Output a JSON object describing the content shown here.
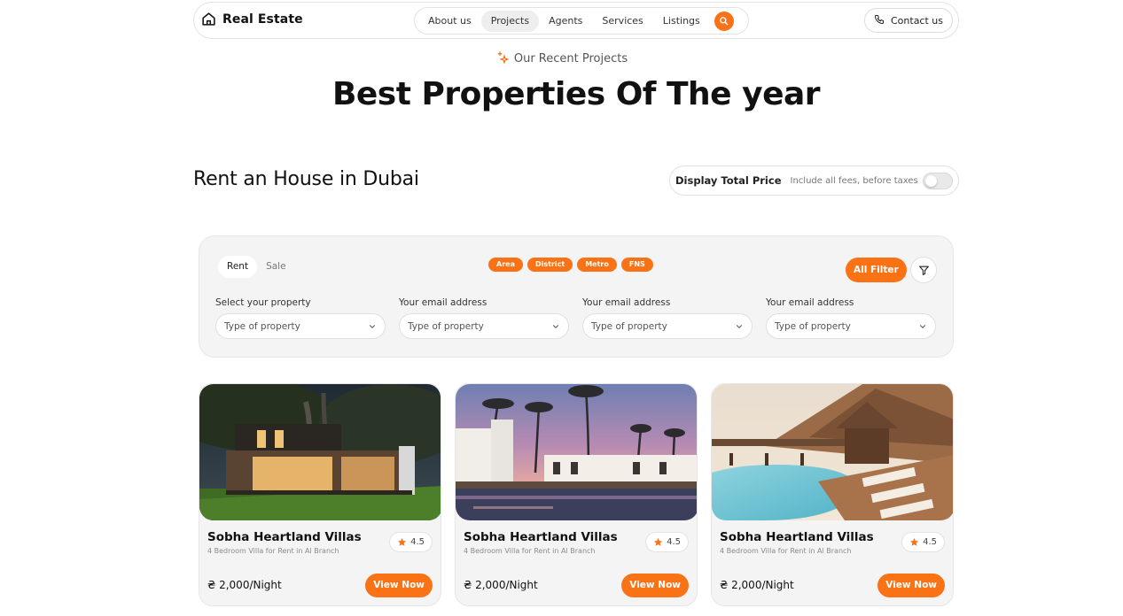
{
  "brand": {
    "name": "Real Estate",
    "accent": "#f97316"
  },
  "nav": {
    "items": [
      "About us",
      "Projects",
      "Agents",
      "Services",
      "Listings"
    ],
    "active": "Projects",
    "contact_label": "Contact us"
  },
  "hero": {
    "eyebrow": "Our Recent Projects",
    "title": "Best Properties Of The year"
  },
  "section": {
    "title": "Rent an House in Dubai",
    "price_toggle": {
      "label": "Display Total Price",
      "sublabel": "Include all fees, before taxes",
      "on": false
    }
  },
  "filters": {
    "modes": [
      "Rent",
      "Sale"
    ],
    "active_mode": "Rent",
    "chips": [
      "Area",
      "District",
      "Metro",
      "FNS"
    ],
    "all_filter_label": "All Filter",
    "fields": [
      {
        "label": "Select your property",
        "value": "Type of property"
      },
      {
        "label": "Your email address",
        "value": "Type of property"
      },
      {
        "label": "Your email address",
        "value": "Type of property"
      },
      {
        "label": "Your email address",
        "value": "Type of property"
      }
    ]
  },
  "listings": [
    {
      "image": "modern-villa-night-photo",
      "title": "Sobha Heartland Villas",
      "subtitle": "4 Bedroom Villa for Rent in Al Branch",
      "rating": "4.5",
      "price": "₴ 2,000/Night",
      "cta": "View Now"
    },
    {
      "image": "palm-resort-pool-dusk-photo",
      "title": "Sobha Heartland Villas",
      "subtitle": "4 Bedroom Villa for Rent in Al Branch",
      "rating": "4.5",
      "price": "₴ 2,000/Night",
      "cta": "View Now"
    },
    {
      "image": "thatched-resort-pool-photo",
      "title": "Sobha Heartland Villas",
      "subtitle": "4 Bedroom Villa for Rent in Al Branch",
      "rating": "4.5",
      "price": "₴ 2,000/Night",
      "cta": "View Now"
    }
  ]
}
